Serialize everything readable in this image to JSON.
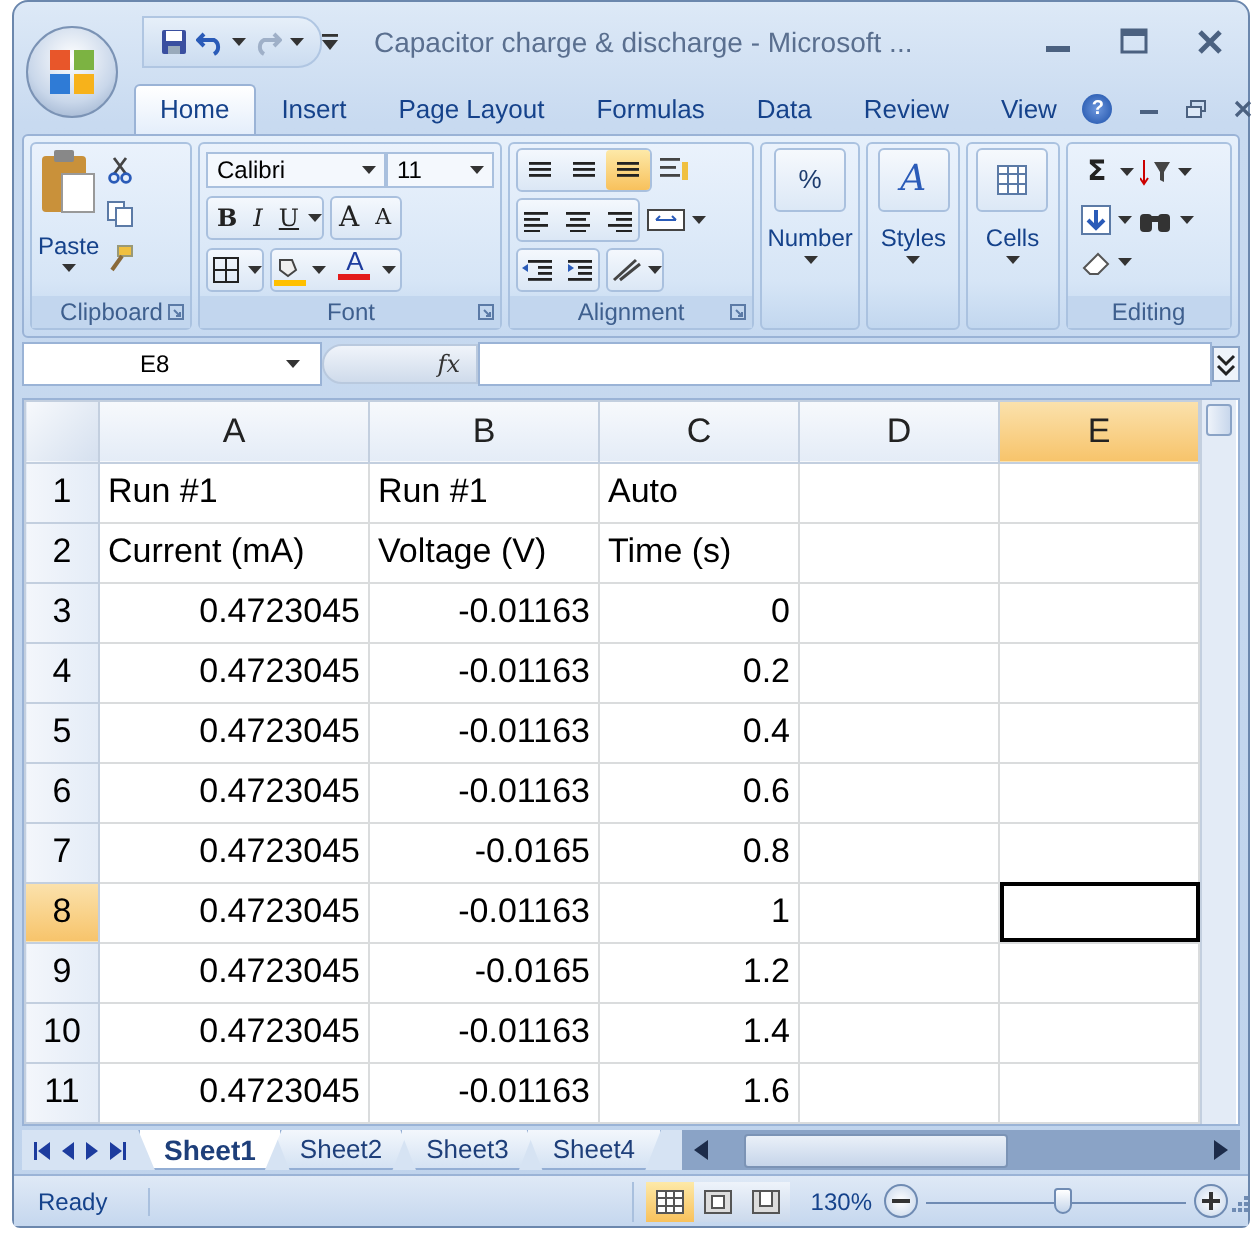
{
  "window": {
    "title": "Capacitor charge & discharge - Microsoft ..."
  },
  "ribbon_tabs": [
    {
      "label": "Home",
      "selected": true
    },
    {
      "label": "Insert",
      "selected": false
    },
    {
      "label": "Page Layout",
      "selected": false
    },
    {
      "label": "Formulas",
      "selected": false
    },
    {
      "label": "Data",
      "selected": false
    },
    {
      "label": "Review",
      "selected": false
    },
    {
      "label": "View",
      "selected": false
    }
  ],
  "help_button": "?",
  "clipboard": {
    "paste_label": "Paste",
    "label": "Clipboard"
  },
  "font": {
    "font_name": "Calibri",
    "font_size": "11",
    "style_buttons": [
      "B",
      "I",
      "U"
    ],
    "size_buttons": [
      "A",
      "A"
    ],
    "font_color_button": "A",
    "label": "Font"
  },
  "alignment": {
    "vertical_align": [
      {
        "selected": false
      },
      {
        "selected": false
      },
      {
        "selected": true
      }
    ],
    "label": "Alignment"
  },
  "number": {
    "symbol": "%",
    "label": "Number"
  },
  "styles": {
    "symbol": "A",
    "label": "Styles"
  },
  "cells": {
    "label": "Cells"
  },
  "editing": {
    "sum_symbol": "Σ",
    "label": "Editing"
  },
  "formula_bar": {
    "name_box": "E8",
    "function_symbol": "fx"
  },
  "sheet": {
    "columns": [
      {
        "label": "A",
        "selected": false
      },
      {
        "label": "B",
        "selected": false
      },
      {
        "label": "C",
        "selected": false
      },
      {
        "label": "D",
        "selected": false
      },
      {
        "label": "E",
        "selected": true
      }
    ],
    "rows": [
      {
        "header": "1",
        "kind": "text",
        "selected": false,
        "cells": [
          "Run #1",
          "Run #1",
          "Auto"
        ]
      },
      {
        "header": "2",
        "kind": "text",
        "selected": false,
        "cells": [
          "Current (mA)",
          "Voltage (V)",
          "Time (s)"
        ]
      },
      {
        "header": "3",
        "kind": "number",
        "selected": false,
        "cells": [
          "0.4723045",
          "-0.01163",
          "0"
        ]
      },
      {
        "header": "4",
        "kind": "number",
        "selected": false,
        "cells": [
          "0.4723045",
          "-0.01163",
          "0.2"
        ]
      },
      {
        "header": "5",
        "kind": "number",
        "selected": false,
        "cells": [
          "0.4723045",
          "-0.01163",
          "0.4"
        ]
      },
      {
        "header": "6",
        "kind": "number",
        "selected": false,
        "cells": [
          "0.4723045",
          "-0.01163",
          "0.6"
        ]
      },
      {
        "header": "7",
        "kind": "number",
        "selected": false,
        "cells": [
          "0.4723045",
          "-0.0165",
          "0.8"
        ]
      },
      {
        "header": "8",
        "kind": "number",
        "selected": true,
        "cells": [
          "0.4723045",
          "-0.01163",
          "1"
        ]
      },
      {
        "header": "9",
        "kind": "number",
        "selected": false,
        "cells": [
          "0.4723045",
          "-0.0165",
          "1.2"
        ]
      },
      {
        "header": "10",
        "kind": "number",
        "selected": false,
        "cells": [
          "0.4723045",
          "-0.01163",
          "1.4"
        ]
      },
      {
        "header": "11",
        "kind": "number",
        "selected": false,
        "cells": [
          "0.4723045",
          "-0.01163",
          "1.6"
        ]
      }
    ]
  },
  "sheet_tabs": [
    {
      "label": "Sheet1",
      "selected": true
    },
    {
      "label": "Sheet2",
      "selected": false
    },
    {
      "label": "Sheet3",
      "selected": false
    },
    {
      "label": "Sheet4",
      "selected": false
    }
  ],
  "status_bar": {
    "status": "Ready",
    "view_buttons": [
      {
        "selected": true
      },
      {
        "selected": false
      },
      {
        "selected": false
      }
    ],
    "zoom": "130%",
    "zoom_slider": {
      "level": 0.52
    }
  }
}
